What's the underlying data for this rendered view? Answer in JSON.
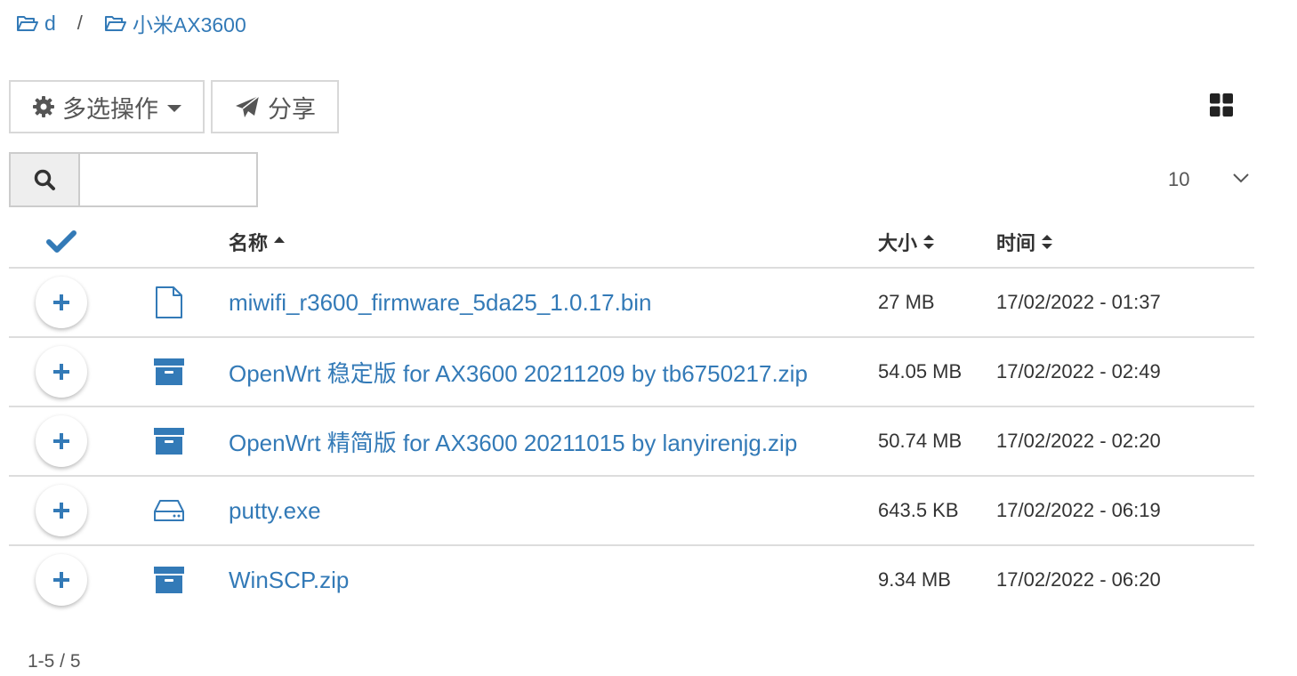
{
  "breadcrumb": [
    {
      "label": "d"
    },
    {
      "label": "小米AX3600"
    }
  ],
  "breadcrumb_separator": "/",
  "toolbar": {
    "multi_select_label": "多选操作",
    "share_label": "分享"
  },
  "search": {
    "value": "",
    "placeholder": ""
  },
  "page_size": {
    "value": "10"
  },
  "table": {
    "headers": {
      "name": "名称",
      "size": "大小",
      "time": "时间"
    },
    "rows": [
      {
        "icon": "file-icon",
        "name": "miwifi_r3600_firmware_5da25_1.0.17.bin",
        "size": "27 MB",
        "time": "17/02/2022 - 01:37"
      },
      {
        "icon": "archive-icon",
        "name": "OpenWrt 稳定版 for AX3600 20211209 by tb6750217.zip",
        "size": "54.05 MB",
        "time": "17/02/2022 - 02:49"
      },
      {
        "icon": "archive-icon",
        "name": "OpenWrt 精简版 for AX3600 20211015 by lanyirenjg.zip",
        "size": "50.74 MB",
        "time": "17/02/2022 - 02:20"
      },
      {
        "icon": "drive-icon",
        "name": "putty.exe",
        "size": "643.5 KB",
        "time": "17/02/2022 - 06:19"
      },
      {
        "icon": "archive-icon",
        "name": "WinSCP.zip",
        "size": "9.34 MB",
        "time": "17/02/2022 - 06:20"
      }
    ]
  },
  "pagination": {
    "info": "1-5 / 5"
  },
  "colors": {
    "link": "#337ab7",
    "border": "#dddddd",
    "text": "#333333"
  }
}
